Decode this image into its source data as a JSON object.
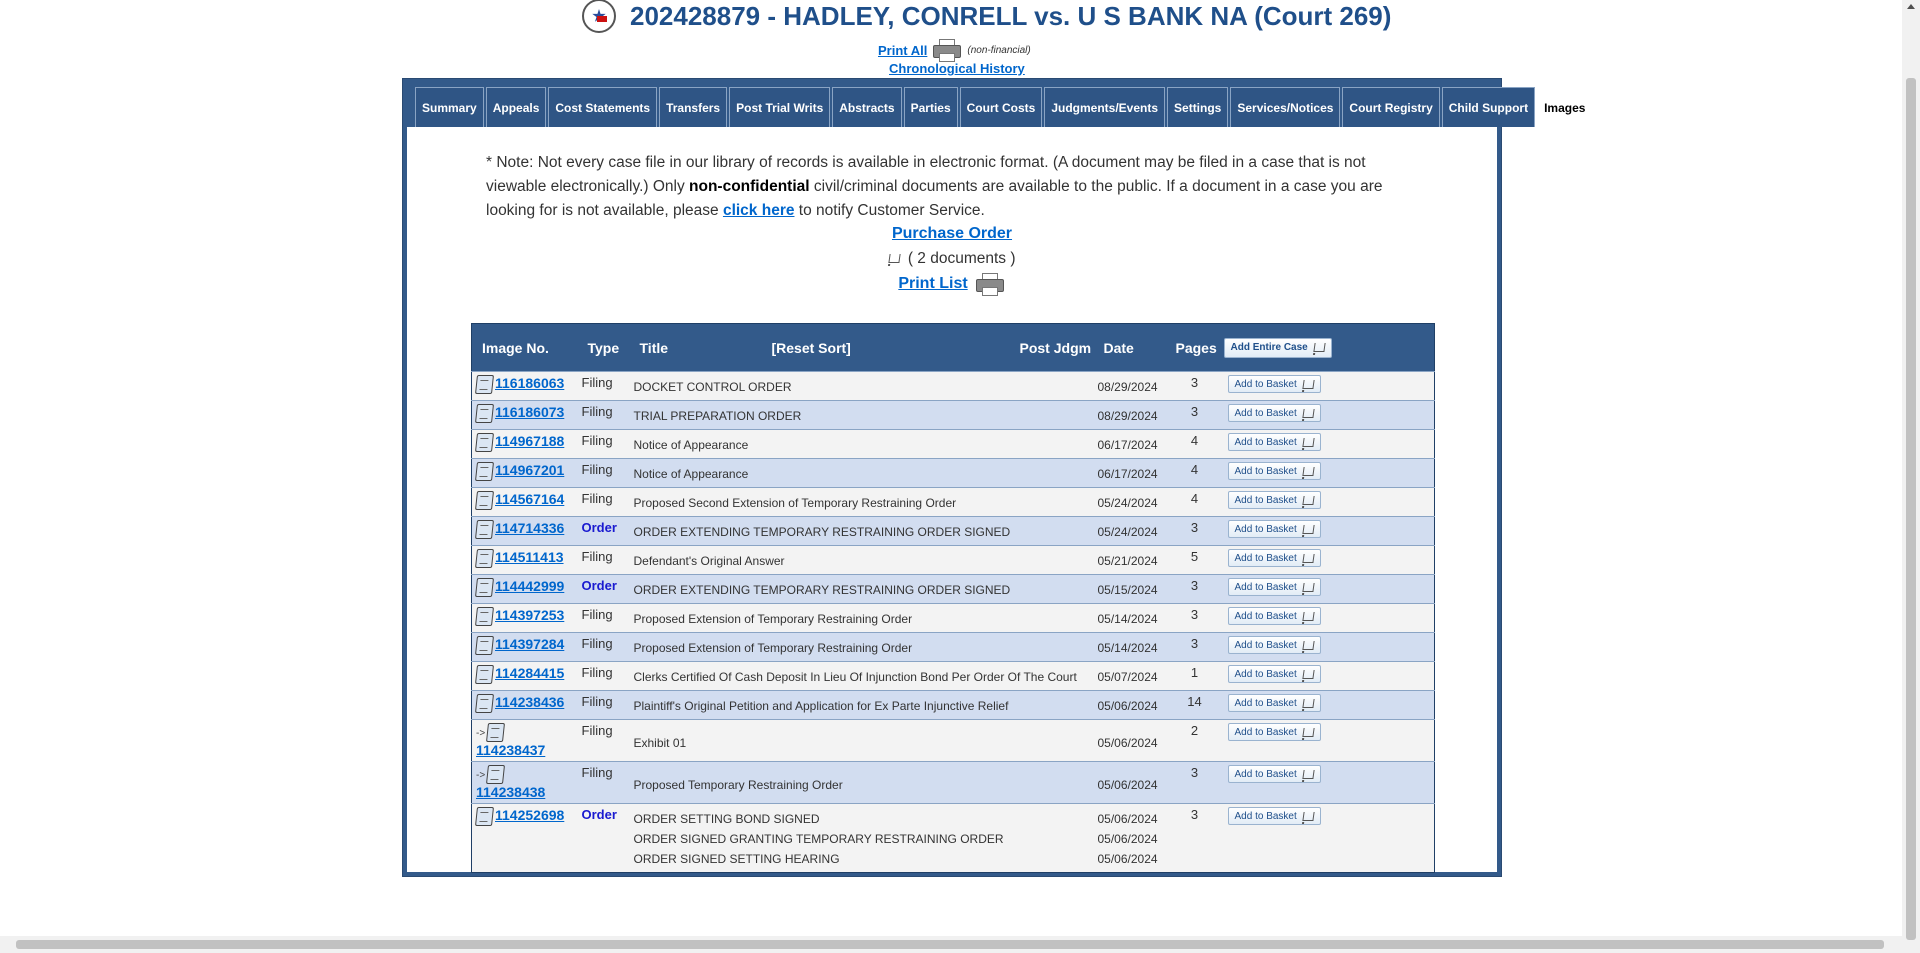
{
  "header": {
    "case_title": "202428879 - HADLEY, CONRELL vs. U S BANK NA (Court 269)",
    "print_all_label": "Print All",
    "non_financial_label": "(non-financial)",
    "chronological_history_label": "Chronological History"
  },
  "tabs": [
    {
      "label": "Summary"
    },
    {
      "label": "Appeals"
    },
    {
      "label": "Cost Statements"
    },
    {
      "label": "Transfers"
    },
    {
      "label": "Post Trial Writs"
    },
    {
      "label": "Abstracts"
    },
    {
      "label": "Parties"
    },
    {
      "label": "Court Costs"
    },
    {
      "label": "Judgments/Events"
    },
    {
      "label": "Settings"
    },
    {
      "label": "Services/Notices"
    },
    {
      "label": "Court Registry"
    },
    {
      "label": "Child Support"
    },
    {
      "label": "Images"
    }
  ],
  "active_tab": "Images",
  "note": {
    "text1": "* Note: Not every case file in our library of records is available in electronic format. (A document may be filed in a case that is not viewable electronically.) Only ",
    "bold": "non-confidential",
    "text2": " civil/criminal documents are available to the public. If a document in a case you are looking for is not available, please ",
    "link": "click here",
    "text3": " to notify Customer Service."
  },
  "purchase_order_label": "Purchase Order",
  "document_count_text": "( 2 documents )",
  "print_list_label": "Print List",
  "table": {
    "headers": {
      "image_no": "Image No.",
      "type": "Type",
      "title": "Title",
      "reset_sort": "[Reset Sort]",
      "post_jdgm": "Post Jdgm",
      "date": "Date",
      "pages": "Pages",
      "add_entire_case": "Add Entire Case"
    },
    "add_to_basket_label": "Add to Basket",
    "rows": [
      {
        "image_no": "116186063",
        "type": "Filing",
        "titles": [
          "DOCKET CONTROL ORDER"
        ],
        "dates": [
          "08/29/2024"
        ],
        "pages": "3",
        "sub": false
      },
      {
        "image_no": "116186073",
        "type": "Filing",
        "titles": [
          "TRIAL PREPARATION ORDER"
        ],
        "dates": [
          "08/29/2024"
        ],
        "pages": "3",
        "sub": false
      },
      {
        "image_no": "114967188",
        "type": "Filing",
        "titles": [
          "Notice of Appearance"
        ],
        "dates": [
          "06/17/2024"
        ],
        "pages": "4",
        "sub": false
      },
      {
        "image_no": "114967201",
        "type": "Filing",
        "titles": [
          "Notice of Appearance"
        ],
        "dates": [
          "06/17/2024"
        ],
        "pages": "4",
        "sub": false
      },
      {
        "image_no": "114567164",
        "type": "Filing",
        "titles": [
          "Proposed Second Extension of Temporary Restraining Order"
        ],
        "dates": [
          "05/24/2024"
        ],
        "pages": "4",
        "sub": false
      },
      {
        "image_no": "114714336",
        "type": "Order",
        "titles": [
          "ORDER EXTENDING TEMPORARY RESTRAINING ORDER SIGNED"
        ],
        "dates": [
          "05/24/2024"
        ],
        "pages": "3",
        "sub": false
      },
      {
        "image_no": "114511413",
        "type": "Filing",
        "titles": [
          "Defendant's Original Answer"
        ],
        "dates": [
          "05/21/2024"
        ],
        "pages": "5",
        "sub": false
      },
      {
        "image_no": "114442999",
        "type": "Order",
        "titles": [
          "ORDER EXTENDING TEMPORARY RESTRAINING ORDER SIGNED"
        ],
        "dates": [
          "05/15/2024"
        ],
        "pages": "3",
        "sub": false
      },
      {
        "image_no": "114397253",
        "type": "Filing",
        "titles": [
          "Proposed Extension of Temporary Restraining Order"
        ],
        "dates": [
          "05/14/2024"
        ],
        "pages": "3",
        "sub": false
      },
      {
        "image_no": "114397284",
        "type": "Filing",
        "titles": [
          "Proposed Extension of Temporary Restraining Order"
        ],
        "dates": [
          "05/14/2024"
        ],
        "pages": "3",
        "sub": false
      },
      {
        "image_no": "114284415",
        "type": "Filing",
        "titles": [
          "Clerks Certified Of Cash Deposit In Lieu Of Injunction Bond Per Order Of The Court"
        ],
        "dates": [
          "05/07/2024"
        ],
        "pages": "1",
        "sub": false
      },
      {
        "image_no": "114238436",
        "type": "Filing",
        "titles": [
          "Plaintiff's Original Petition and Application for Ex Parte Injunctive Relief"
        ],
        "dates": [
          "05/06/2024"
        ],
        "pages": "14",
        "sub": false
      },
      {
        "image_no": "114238437",
        "type": "Filing",
        "titles": [
          "Exhibit 01"
        ],
        "dates": [
          "05/06/2024"
        ],
        "pages": "2",
        "sub": true
      },
      {
        "image_no": "114238438",
        "type": "Filing",
        "titles": [
          "Proposed Temporary Restraining Order"
        ],
        "dates": [
          "05/06/2024"
        ],
        "pages": "3",
        "sub": true
      },
      {
        "image_no": "114252698",
        "type": "Order",
        "titles": [
          "ORDER SETTING BOND SIGNED",
          "ORDER SIGNED GRANTING TEMPORARY RESTRAINING ORDER",
          "ORDER SIGNED SETTING HEARING"
        ],
        "dates": [
          "05/06/2024",
          "05/06/2024",
          "05/06/2024"
        ],
        "pages": "3",
        "sub": false
      }
    ]
  },
  "colors": {
    "header_blue": "#335a8a",
    "title_blue": "#1f4f8a",
    "link_blue": "#0066cc",
    "order_blue": "#1a1ad0",
    "row_odd": "#f3f3f3",
    "row_even": "#d2ddf0"
  },
  "icons": [
    "texas-seal-icon",
    "printer-icon",
    "cart-icon",
    "document-icon"
  ]
}
